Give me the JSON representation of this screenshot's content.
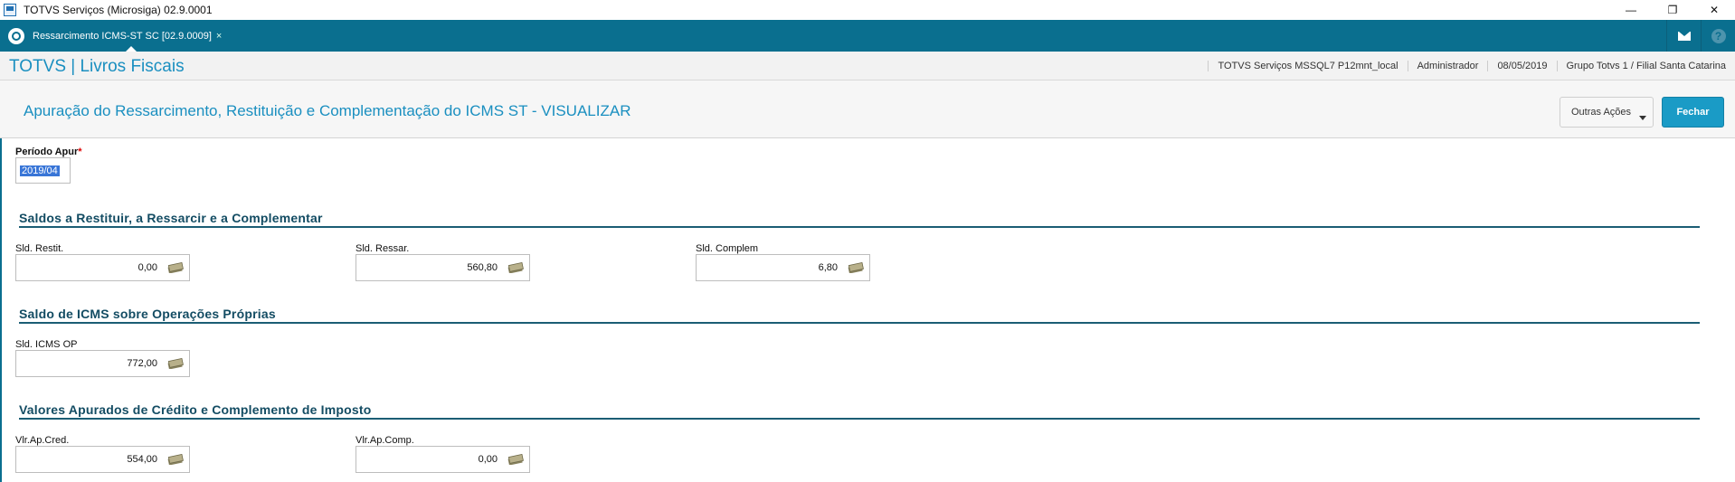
{
  "window": {
    "title": "TOTVS Serviços (Microsiga) 02.9.0001",
    "buttons": {
      "minimize": "—",
      "restore": "❐",
      "close": "✕"
    }
  },
  "tabbar": {
    "active_tab": "Ressarcimento ICMS-ST SC [02.9.0009]",
    "close_glyph": "×"
  },
  "header": {
    "brand": "TOTVS | Livros Fiscais",
    "info": [
      "TOTVS Serviços MSSQL7 P12mnt_local",
      "Administrador",
      "08/05/2019",
      "Grupo Totvs 1 / Filial Santa Catarina"
    ]
  },
  "page": {
    "title": "Apuração do Ressarcimento, Restituição e Complementação do ICMS ST - VISUALIZAR",
    "outras_acoes": "Outras Ações",
    "fechar": "Fechar"
  },
  "form": {
    "periodo": {
      "label": "Período Apur",
      "required_mark": "*",
      "value": "2019/04"
    },
    "sections": [
      {
        "title": "Saldos a Restituir, a Ressarcir e a Complementar",
        "fields": [
          {
            "label": "Sld. Restit.",
            "value": "0,00"
          },
          {
            "label": "Sld. Ressar.",
            "value": "560,80"
          },
          {
            "label": "Sld. Complem",
            "value": "6,80"
          }
        ]
      },
      {
        "title": "Saldo de ICMS sobre Operações Próprias",
        "fields": [
          {
            "label": "Sld. ICMS OP",
            "value": "772,00"
          }
        ]
      },
      {
        "title": "Valores Apurados de Crédito e Complemento de Imposto",
        "fields": [
          {
            "label": "Vlr.Ap.Cred.",
            "value": "554,00"
          },
          {
            "label": "Vlr.Ap.Comp.",
            "value": "0,00"
          }
        ]
      }
    ]
  },
  "icons": {
    "field_icon": "money-icon",
    "home": "totvs-home-icon",
    "mail": "mail-icon",
    "help": "help-icon"
  },
  "colors": {
    "accent": "#0a6f8f",
    "primary_button": "#1a9bc6",
    "title_text": "#1a8fc0",
    "section_text": "#134c63"
  }
}
